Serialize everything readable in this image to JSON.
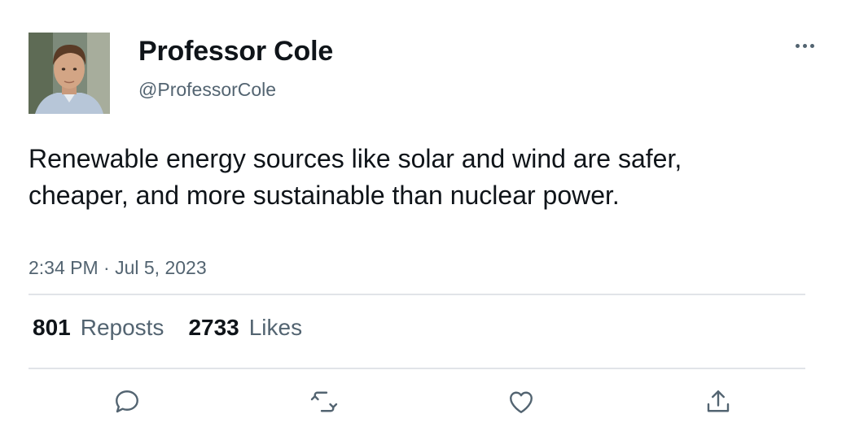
{
  "author": {
    "display_name": "Professor Cole",
    "handle": "@ProfessorCole"
  },
  "tweet": {
    "text": "Renewable energy sources like solar and wind are safer, cheaper, and more sustainable than nuclear power.",
    "timestamp": "2:34 PM · Jul 5, 2023"
  },
  "stats": {
    "reposts_count": "801",
    "reposts_label": "Reposts",
    "likes_count": "2733",
    "likes_label": "Likes"
  },
  "icons": {
    "more": "more-horizontal-icon",
    "reply": "reply-icon",
    "repost": "repost-icon",
    "like": "heart-icon",
    "share": "share-icon"
  },
  "colors": {
    "text_primary": "#0f1419",
    "text_secondary": "#536471",
    "divider": "#e1e4e8"
  }
}
